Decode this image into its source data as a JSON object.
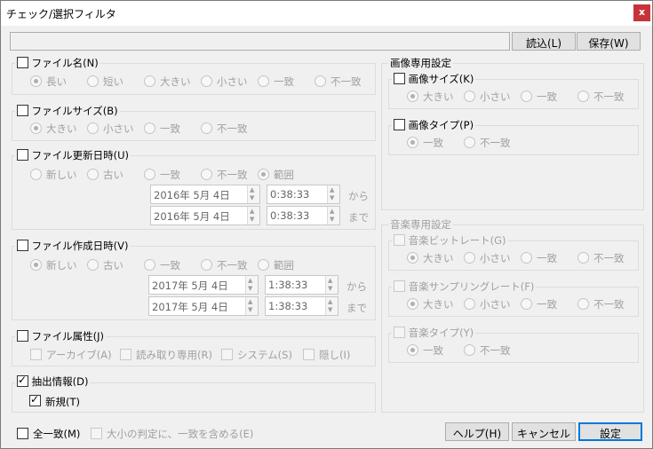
{
  "window": {
    "title": "チェック/選択フィルタ",
    "close_label": "x"
  },
  "toolbar": {
    "filter_value": "",
    "read_label": "読込(L)",
    "save_label": "保存(W)"
  },
  "file_name": {
    "label": "ファイル名(N)",
    "checked": false,
    "options": [
      "長い",
      "短い",
      "大きい",
      "小さい",
      "一致",
      "不一致"
    ],
    "selected": "長い"
  },
  "file_size": {
    "label": "ファイルサイズ(B)",
    "checked": false,
    "options": [
      "大きい",
      "小さい",
      "一致",
      "不一致"
    ],
    "selected": "大きい"
  },
  "file_modified": {
    "label": "ファイル更新日時(U)",
    "checked": false,
    "options": [
      "新しい",
      "古い",
      "一致",
      "不一致",
      "範囲"
    ],
    "selected": "範囲",
    "from_date": "2016年  5月  4日",
    "from_time": "0:38:33",
    "to_date": "2016年  5月  4日",
    "to_time": "0:38:33",
    "from_label": "から",
    "to_label": "まで"
  },
  "file_created": {
    "label": "ファイル作成日時(V)",
    "checked": false,
    "options": [
      "新しい",
      "古い",
      "一致",
      "不一致",
      "範囲"
    ],
    "selected": "新しい",
    "from_date": "2017年  5月  4日",
    "from_time": "1:38:33",
    "to_date": "2017年  5月  4日",
    "to_time": "1:38:33",
    "from_label": "から",
    "to_label": "まで"
  },
  "file_attr": {
    "label": "ファイル属性(J)",
    "checked": false,
    "options": [
      "アーカイブ(A)",
      "読み取り専用(R)",
      "システム(S)",
      "隠し(I)"
    ]
  },
  "extract": {
    "label": "抽出情報(D)",
    "checked": true,
    "new_label": "新規(T)",
    "new_checked": true
  },
  "image_settings": {
    "title": "画像専用設定",
    "size": {
      "label": "画像サイズ(K)",
      "checked": false,
      "options": [
        "大きい",
        "小さい",
        "一致",
        "不一致"
      ],
      "selected": "大きい"
    },
    "type": {
      "label": "画像タイプ(P)",
      "checked": false,
      "options": [
        "一致",
        "不一致"
      ],
      "selected": "一致"
    }
  },
  "music_settings": {
    "title": "音楽専用設定",
    "bitrate": {
      "label": "音楽ビットレート(G)",
      "checked": false,
      "options": [
        "大きい",
        "小さい",
        "一致",
        "不一致"
      ],
      "selected": "大きい"
    },
    "sampling": {
      "label": "音楽サンプリングレート(F)",
      "checked": false,
      "options": [
        "大きい",
        "小さい",
        "一致",
        "不一致"
      ],
      "selected": "大きい"
    },
    "type": {
      "label": "音楽タイプ(Y)",
      "checked": false,
      "options": [
        "一致",
        "不一致"
      ],
      "selected": "一致"
    }
  },
  "bottom": {
    "all_match_label": "全一致(M)",
    "case_label": "大小の判定に、一致を含める(E)",
    "help_label": "ヘルプ(H)",
    "cancel_label": "キャンセル",
    "ok_label": "設定"
  }
}
